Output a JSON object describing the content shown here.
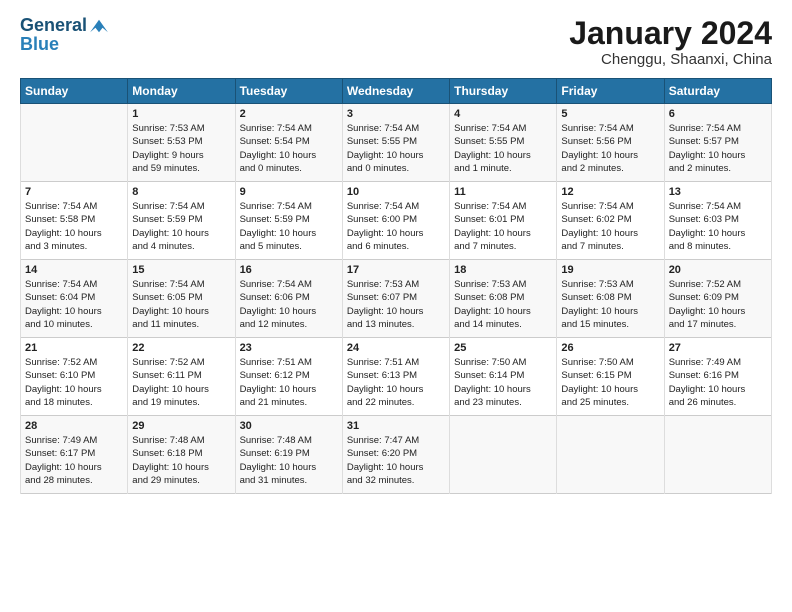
{
  "logo": {
    "line1": "General",
    "line2": "Blue"
  },
  "title": "January 2024",
  "subtitle": "Chenggu, Shaanxi, China",
  "days_header": [
    "Sunday",
    "Monday",
    "Tuesday",
    "Wednesday",
    "Thursday",
    "Friday",
    "Saturday"
  ],
  "weeks": [
    [
      {
        "day": "",
        "text": ""
      },
      {
        "day": "1",
        "text": "Sunrise: 7:53 AM\nSunset: 5:53 PM\nDaylight: 9 hours\nand 59 minutes."
      },
      {
        "day": "2",
        "text": "Sunrise: 7:54 AM\nSunset: 5:54 PM\nDaylight: 10 hours\nand 0 minutes."
      },
      {
        "day": "3",
        "text": "Sunrise: 7:54 AM\nSunset: 5:55 PM\nDaylight: 10 hours\nand 0 minutes."
      },
      {
        "day": "4",
        "text": "Sunrise: 7:54 AM\nSunset: 5:55 PM\nDaylight: 10 hours\nand 1 minute."
      },
      {
        "day": "5",
        "text": "Sunrise: 7:54 AM\nSunset: 5:56 PM\nDaylight: 10 hours\nand 2 minutes."
      },
      {
        "day": "6",
        "text": "Sunrise: 7:54 AM\nSunset: 5:57 PM\nDaylight: 10 hours\nand 2 minutes."
      }
    ],
    [
      {
        "day": "7",
        "text": "Sunrise: 7:54 AM\nSunset: 5:58 PM\nDaylight: 10 hours\nand 3 minutes."
      },
      {
        "day": "8",
        "text": "Sunrise: 7:54 AM\nSunset: 5:59 PM\nDaylight: 10 hours\nand 4 minutes."
      },
      {
        "day": "9",
        "text": "Sunrise: 7:54 AM\nSunset: 5:59 PM\nDaylight: 10 hours\nand 5 minutes."
      },
      {
        "day": "10",
        "text": "Sunrise: 7:54 AM\nSunset: 6:00 PM\nDaylight: 10 hours\nand 6 minutes."
      },
      {
        "day": "11",
        "text": "Sunrise: 7:54 AM\nSunset: 6:01 PM\nDaylight: 10 hours\nand 7 minutes."
      },
      {
        "day": "12",
        "text": "Sunrise: 7:54 AM\nSunset: 6:02 PM\nDaylight: 10 hours\nand 7 minutes."
      },
      {
        "day": "13",
        "text": "Sunrise: 7:54 AM\nSunset: 6:03 PM\nDaylight: 10 hours\nand 8 minutes."
      }
    ],
    [
      {
        "day": "14",
        "text": "Sunrise: 7:54 AM\nSunset: 6:04 PM\nDaylight: 10 hours\nand 10 minutes."
      },
      {
        "day": "15",
        "text": "Sunrise: 7:54 AM\nSunset: 6:05 PM\nDaylight: 10 hours\nand 11 minutes."
      },
      {
        "day": "16",
        "text": "Sunrise: 7:54 AM\nSunset: 6:06 PM\nDaylight: 10 hours\nand 12 minutes."
      },
      {
        "day": "17",
        "text": "Sunrise: 7:53 AM\nSunset: 6:07 PM\nDaylight: 10 hours\nand 13 minutes."
      },
      {
        "day": "18",
        "text": "Sunrise: 7:53 AM\nSunset: 6:08 PM\nDaylight: 10 hours\nand 14 minutes."
      },
      {
        "day": "19",
        "text": "Sunrise: 7:53 AM\nSunset: 6:08 PM\nDaylight: 10 hours\nand 15 minutes."
      },
      {
        "day": "20",
        "text": "Sunrise: 7:52 AM\nSunset: 6:09 PM\nDaylight: 10 hours\nand 17 minutes."
      }
    ],
    [
      {
        "day": "21",
        "text": "Sunrise: 7:52 AM\nSunset: 6:10 PM\nDaylight: 10 hours\nand 18 minutes."
      },
      {
        "day": "22",
        "text": "Sunrise: 7:52 AM\nSunset: 6:11 PM\nDaylight: 10 hours\nand 19 minutes."
      },
      {
        "day": "23",
        "text": "Sunrise: 7:51 AM\nSunset: 6:12 PM\nDaylight: 10 hours\nand 21 minutes."
      },
      {
        "day": "24",
        "text": "Sunrise: 7:51 AM\nSunset: 6:13 PM\nDaylight: 10 hours\nand 22 minutes."
      },
      {
        "day": "25",
        "text": "Sunrise: 7:50 AM\nSunset: 6:14 PM\nDaylight: 10 hours\nand 23 minutes."
      },
      {
        "day": "26",
        "text": "Sunrise: 7:50 AM\nSunset: 6:15 PM\nDaylight: 10 hours\nand 25 minutes."
      },
      {
        "day": "27",
        "text": "Sunrise: 7:49 AM\nSunset: 6:16 PM\nDaylight: 10 hours\nand 26 minutes."
      }
    ],
    [
      {
        "day": "28",
        "text": "Sunrise: 7:49 AM\nSunset: 6:17 PM\nDaylight: 10 hours\nand 28 minutes."
      },
      {
        "day": "29",
        "text": "Sunrise: 7:48 AM\nSunset: 6:18 PM\nDaylight: 10 hours\nand 29 minutes."
      },
      {
        "day": "30",
        "text": "Sunrise: 7:48 AM\nSunset: 6:19 PM\nDaylight: 10 hours\nand 31 minutes."
      },
      {
        "day": "31",
        "text": "Sunrise: 7:47 AM\nSunset: 6:20 PM\nDaylight: 10 hours\nand 32 minutes."
      },
      {
        "day": "",
        "text": ""
      },
      {
        "day": "",
        "text": ""
      },
      {
        "day": "",
        "text": ""
      }
    ]
  ]
}
